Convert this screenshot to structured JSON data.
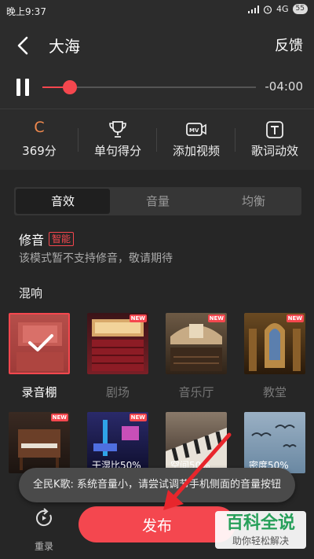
{
  "status": {
    "time": "晚上9:37",
    "signal": "4G",
    "battery": "55"
  },
  "header": {
    "title": "大海",
    "feedback": "反馈"
  },
  "player": {
    "duration": "-04:00",
    "progress": 0.13
  },
  "actions": [
    {
      "grade": "C",
      "label": "369分"
    },
    {
      "label": "单句得分",
      "icon": "trophy-icon"
    },
    {
      "label": "添加视频",
      "icon": "mv-icon"
    },
    {
      "label": "歌词动效",
      "icon": "text-effect-icon"
    }
  ],
  "tabs": [
    "音效",
    "音量",
    "均衡"
  ],
  "repair": {
    "label": "修音",
    "badge": "智能",
    "note": "该模式暂不支持修音，敬请期待"
  },
  "reverb": {
    "title": "混响",
    "row1": [
      {
        "label": "录音棚",
        "selected": true,
        "new": false
      },
      {
        "label": "剧场",
        "selected": false,
        "new": true
      },
      {
        "label": "音乐厅",
        "selected": false,
        "new": true
      },
      {
        "label": "教堂",
        "selected": false,
        "new": true
      }
    ],
    "row2": [
      {
        "overlay": "",
        "new": true
      },
      {
        "overlay": "干湿比50%",
        "new": true
      },
      {
        "overlay": "空间50%",
        "new": false
      },
      {
        "overlay": "密度50%",
        "new": false
      }
    ],
    "new_badge": "NEW"
  },
  "toast": "全民K歌: 系统音量小，请尝试调节手机侧面的音量按钮",
  "bottom": {
    "rerecord": "重录",
    "publish": "发布"
  },
  "watermark": {
    "title": "百科全说",
    "subtitle": "助你轻松解决"
  },
  "colors": {
    "accent": "#f5474e",
    "grade": "#f0894e"
  }
}
